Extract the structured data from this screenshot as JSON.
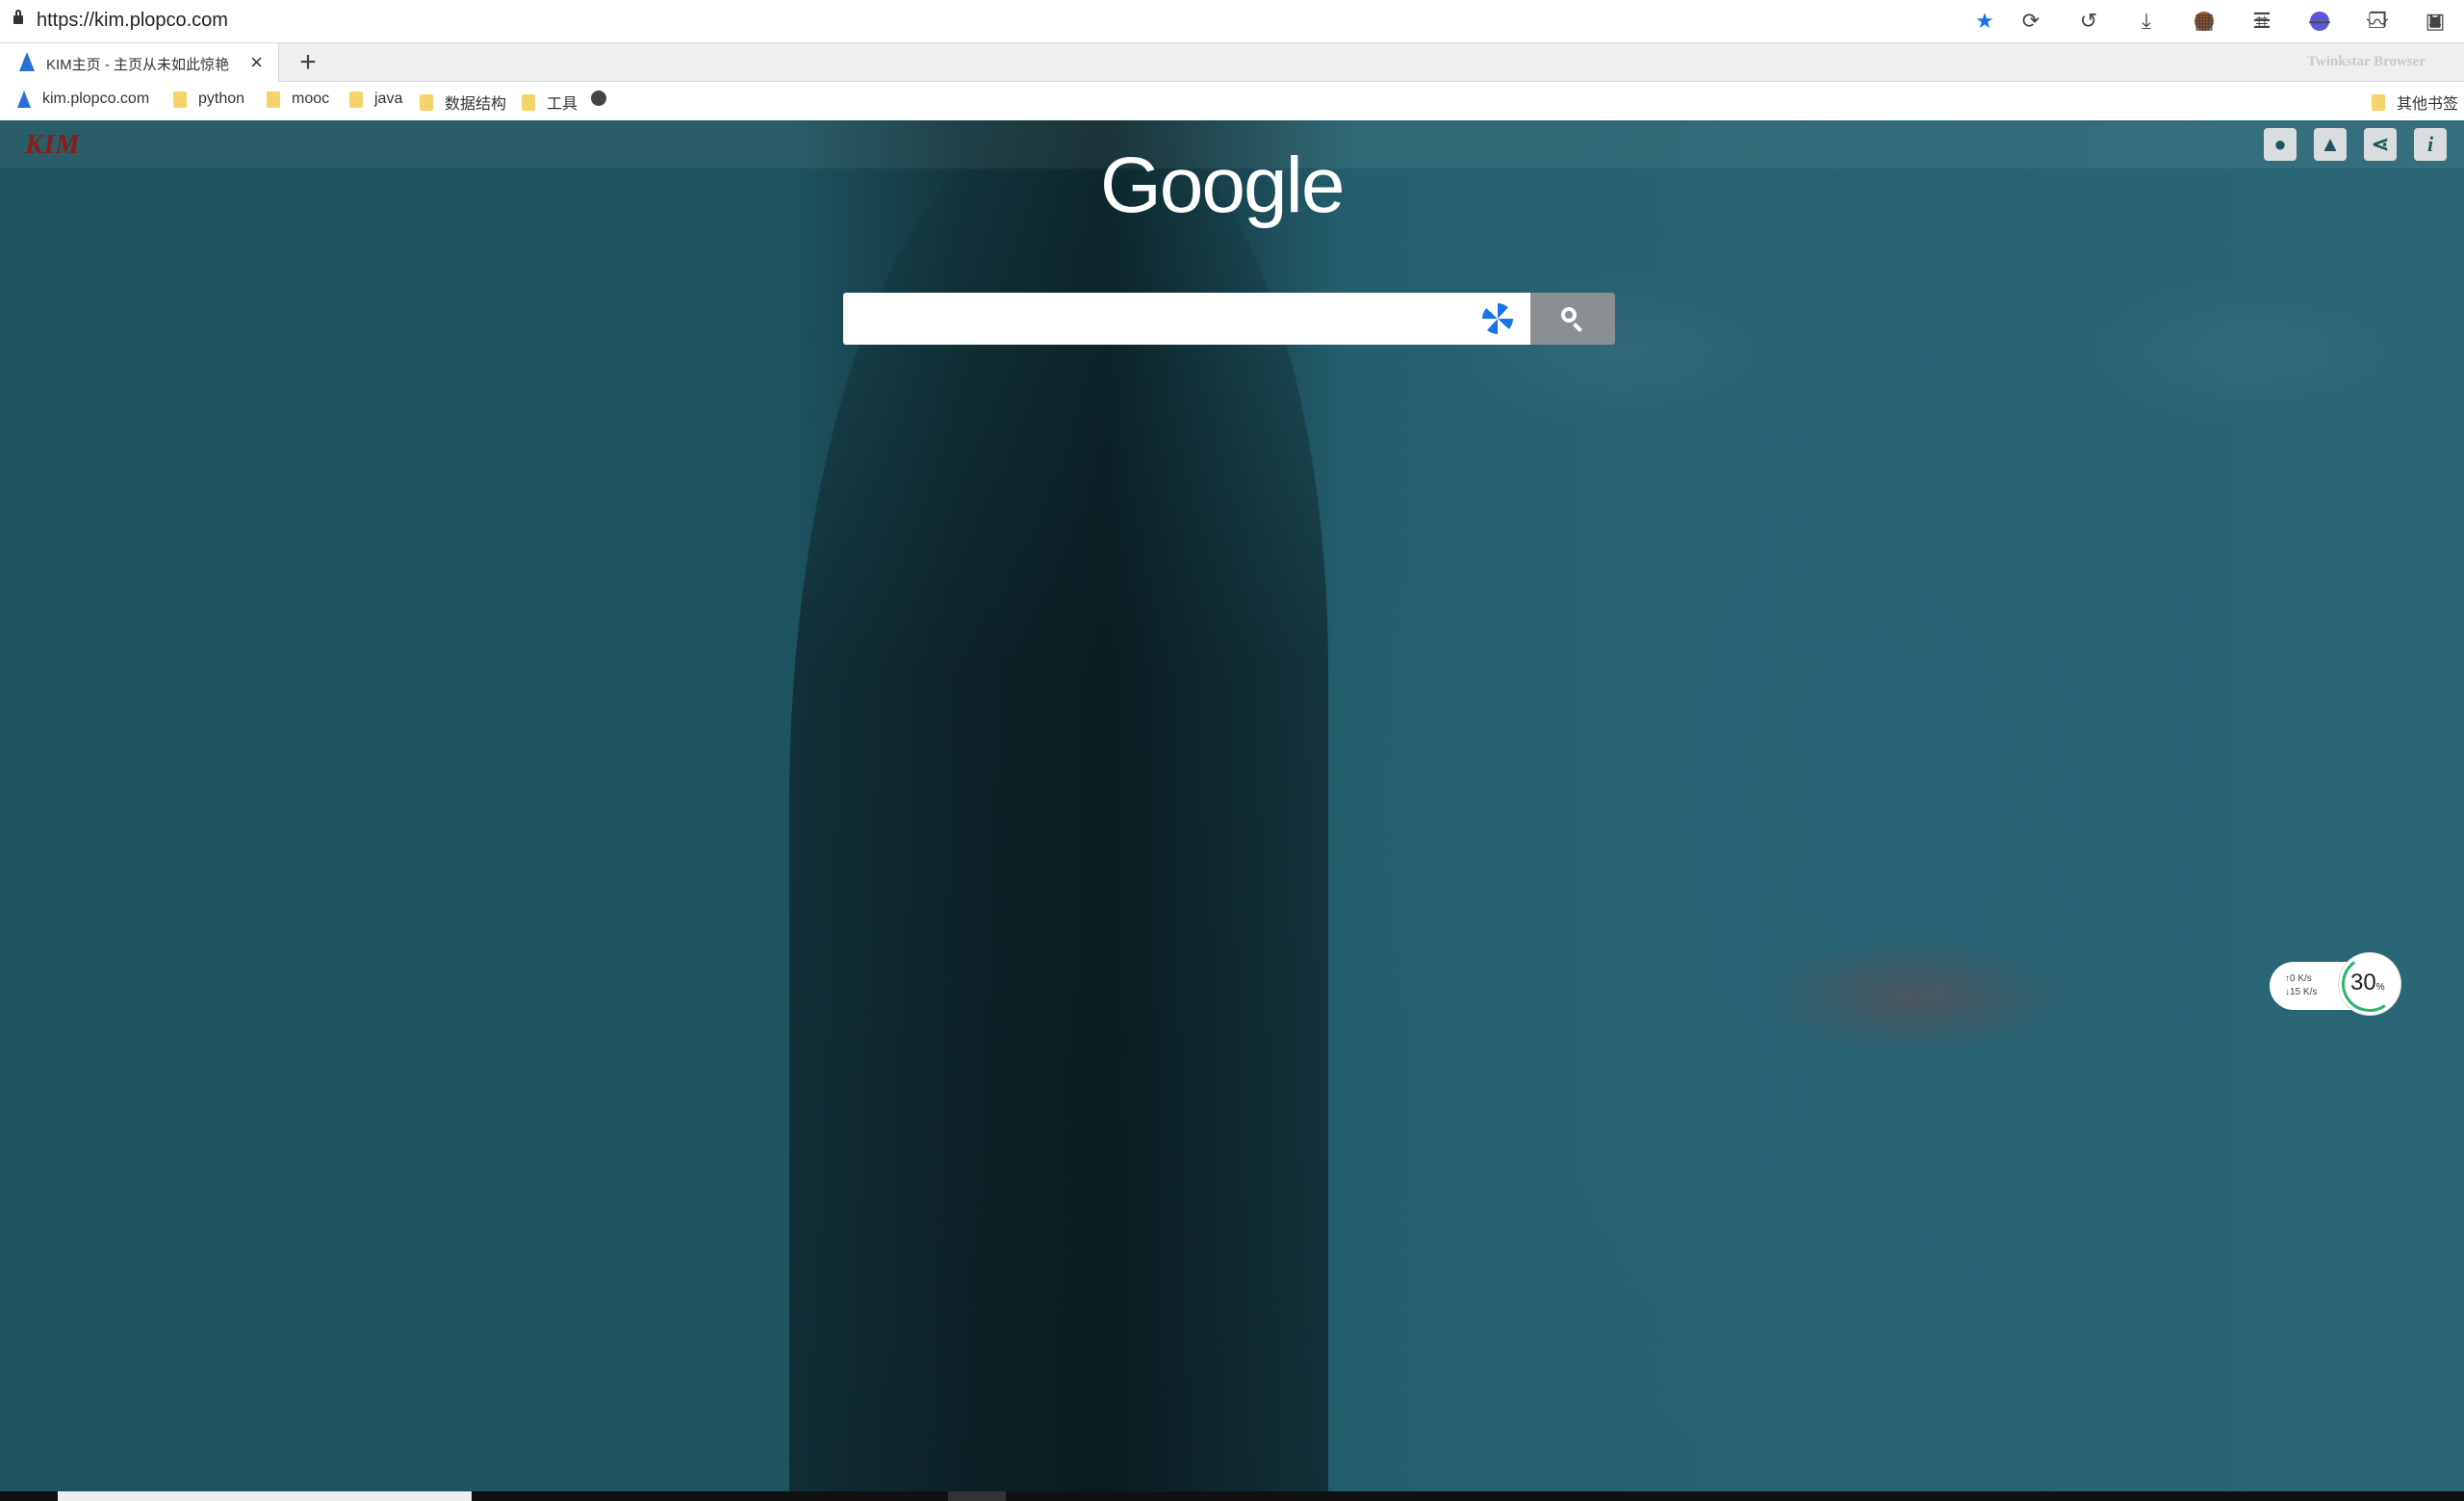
{
  "browser": {
    "url": "https://kim.plopco.com",
    "brand": "Twinkstar Browser",
    "toolbar_icons": [
      "star-icon",
      "refresh-icon",
      "undo-icon",
      "download-icon",
      "extension-icon",
      "crop-icon",
      "shield-icon",
      "chart-icon",
      "image-icon",
      "qr-icon",
      "menu-icon",
      "minimize-icon",
      "restore-icon",
      "close-icon"
    ]
  },
  "tabs": [
    {
      "title": "KIM主页 - 主页从未如此惊艳",
      "close": "×"
    }
  ],
  "new_tab": "+",
  "bookmarks": {
    "items": [
      {
        "label": "kim.plopco.com",
        "icon": "site-icon"
      },
      {
        "label": "python",
        "icon": "folder-icon"
      },
      {
        "label": "mooc",
        "icon": "folder-icon"
      },
      {
        "label": "java",
        "icon": "folder-icon"
      },
      {
        "label": "数据结构",
        "icon": "folder-icon"
      },
      {
        "label": "工具",
        "icon": "folder-icon"
      }
    ],
    "other": "其他书签"
  },
  "page": {
    "logo": "KIM",
    "google": "Google",
    "search_placeholder": "",
    "right_icons": [
      "user-icon",
      "image-icon",
      "share-icon",
      "info-icon"
    ],
    "info_glyph": "i"
  },
  "net": {
    "up": "0",
    "down": "15",
    "unit": "K/s",
    "percent": "30",
    "percent_unit": "%"
  }
}
